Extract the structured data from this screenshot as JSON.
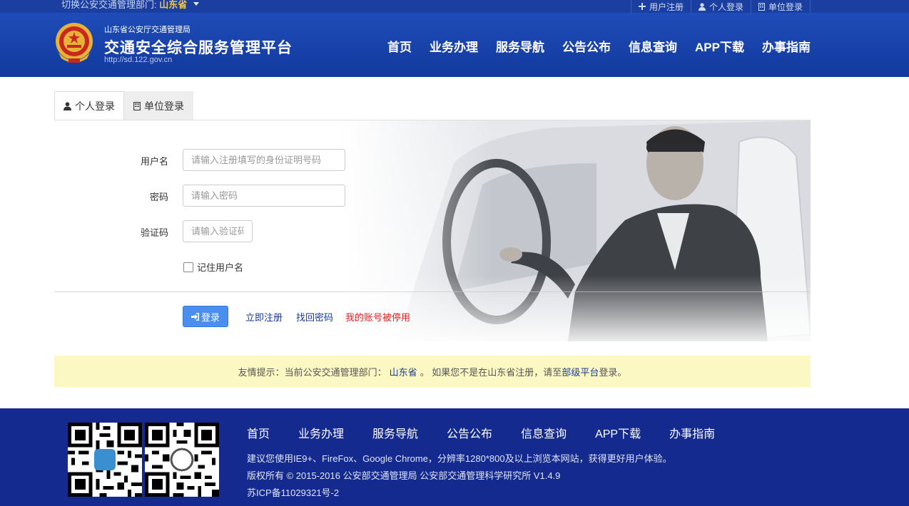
{
  "topbar": {
    "switch_prefix": "切换公安交通管理部门:",
    "province": "山东省",
    "links": [
      {
        "icon": "plus-icon",
        "label": "用户注册"
      },
      {
        "icon": "user-icon",
        "label": "个人登录"
      },
      {
        "icon": "building-icon",
        "label": "单位登录"
      }
    ]
  },
  "header": {
    "org": "山东省公安厅交通管理局",
    "title": "交通安全综合服务管理平台",
    "url": "http://sd.122.gov.cn",
    "emblem": "police-emblem-icon",
    "nav": [
      "首页",
      "业务办理",
      "服务导航",
      "公告公布",
      "信息查询",
      "APP下载",
      "办事指南"
    ]
  },
  "tabs": [
    {
      "icon": "user-icon",
      "label": "个人登录",
      "active": true
    },
    {
      "icon": "building-icon",
      "label": "单位登录",
      "active": false
    }
  ],
  "form": {
    "username": {
      "label": "用户名",
      "placeholder": "请输入注册填写的身份证明号码",
      "value": ""
    },
    "password": {
      "label": "密码",
      "placeholder": "请输入密码",
      "value": ""
    },
    "captcha": {
      "label": "验证码",
      "placeholder": "请输入验证码",
      "value": ""
    },
    "remember": {
      "label": "记住用户名",
      "checked": false
    },
    "login_button": "登录",
    "links": {
      "register": "立即注册",
      "recover": "找回密码",
      "suspended": "我的账号被停用"
    }
  },
  "notice": {
    "prefix": "友情提示：当前公安交通管理部门：",
    "province": "山东省",
    "middle": "。 如果您不是在山东省注册，请至",
    "platform_link": "部级平台",
    "suffix": "登录。"
  },
  "footer": {
    "nav": [
      "首页",
      "业务办理",
      "服务导航",
      "公告公布",
      "信息查询",
      "APP下载",
      "办事指南"
    ],
    "browser_tip": "建议您使用IE9+、FireFox、Google Chrome，分辨率1280*800及以上浏览本网站，获得更好用户体验。",
    "copyright": "版权所有 © 2015-2016 公安部交通管理局 公安部交通管理科学研究所 V1.4.9",
    "icp": "苏ICP备11029321号-2",
    "qr_codes": [
      "qr-code-wechat-icon",
      "qr-code-app-icon"
    ]
  },
  "colors": {
    "header_blue": "#1a45ad",
    "footer_blue": "#152a8f",
    "accent_button": "#4a8ef0",
    "notice_bg": "#fcf8c3",
    "warning_red": "#e02020"
  }
}
